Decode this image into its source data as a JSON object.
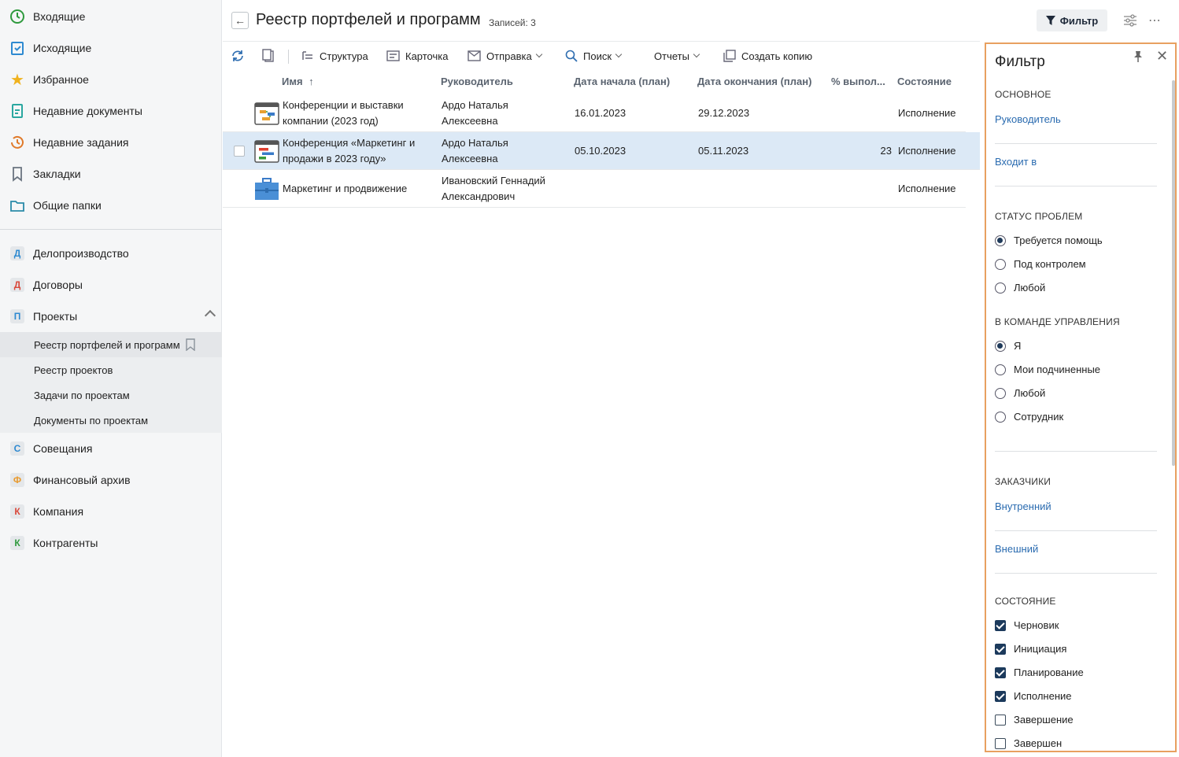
{
  "sidebar": {
    "main": [
      "Входящие",
      "Исходящие",
      "Избранное",
      "Недавние документы",
      "Недавние задания",
      "Закладки",
      "Общие папки"
    ],
    "modules": [
      {
        "letter": "Д",
        "label": "Делопроизводство",
        "color": "#2e8ad1"
      },
      {
        "letter": "Д",
        "label": "Договоры",
        "color": "#d9483b"
      },
      {
        "letter": "П",
        "label": "Проекты",
        "color": "#2e8ad1"
      }
    ],
    "project_sub": [
      "Реестр портфелей и программ",
      "Реестр проектов",
      "Задачи по проектам",
      "Документы по проектам"
    ],
    "modules2": [
      {
        "letter": "С",
        "label": "Совещания",
        "color": "#2e8ad1"
      },
      {
        "letter": "Ф",
        "label": "Финансовый архив",
        "color": "#e89a2e"
      },
      {
        "letter": "К",
        "label": "Компания",
        "color": "#d9483b"
      },
      {
        "letter": "К",
        "label": "Контрагенты",
        "color": "#2f9a3e"
      }
    ]
  },
  "header": {
    "title": "Реестр портфелей и программ",
    "records": "Записей: 3",
    "filter_label": "Фильтр"
  },
  "toolbar": {
    "structure": "Структура",
    "card": "Карточка",
    "send": "Отправка",
    "search": "Поиск",
    "reports": "Отчеты",
    "copy": "Создать копию"
  },
  "table": {
    "columns": [
      "Имя",
      "Руководитель",
      "Дата начала (план)",
      "Дата окончания (план)",
      "% выпол...",
      "Состояние"
    ],
    "rows": [
      {
        "name1": "Конференции и выставки",
        "name2": "компании (2023 год)",
        "mgr1": "Ардо Наталья",
        "mgr2": "Алексеевна",
        "start": "16.01.2023",
        "end": "29.12.2023",
        "pct": "",
        "state": "Исполнение"
      },
      {
        "name1": "Конференция «Маркетинг и",
        "name2": "продажи в 2023 году»",
        "mgr1": "Ардо Наталья",
        "mgr2": "Алексеевна",
        "start": "05.10.2023",
        "end": "05.11.2023",
        "pct": "23",
        "state": "Исполнение"
      },
      {
        "name1": "Маркетинг и продвижение",
        "name2": "",
        "mgr1": "Ивановский Геннадий",
        "mgr2": "Александрович",
        "start": "",
        "end": "",
        "pct": "",
        "state": "Исполнение"
      }
    ]
  },
  "filter": {
    "title": "Фильтр",
    "main_section": "ОСНОВНОЕ",
    "manager_link": "Руководитель",
    "belongs_link": "Входит в",
    "problems_section": "СТАТУС ПРОБЛЕМ",
    "problems": [
      {
        "label": "Требуется помощь",
        "on": true
      },
      {
        "label": "Под контролем",
        "on": false
      },
      {
        "label": "Любой",
        "on": false
      }
    ],
    "team_section": "В КОМАНДЕ УПРАВЛЕНИЯ",
    "team": [
      {
        "label": "Я",
        "on": true
      },
      {
        "label": "Мои подчиненные",
        "on": false
      },
      {
        "label": "Любой",
        "on": false
      },
      {
        "label": "Сотрудник",
        "on": false
      }
    ],
    "customers_section": "ЗАКАЗЧИКИ",
    "internal_link": "Внутренний",
    "external_link": "Внешний",
    "state_section": "СОСТОЯНИЕ",
    "states": [
      {
        "label": "Черновик",
        "on": true
      },
      {
        "label": "Инициация",
        "on": true
      },
      {
        "label": "Планирование",
        "on": true
      },
      {
        "label": "Исполнение",
        "on": true
      },
      {
        "label": "Завершение",
        "on": false
      },
      {
        "label": "Завершен",
        "on": false
      }
    ]
  }
}
